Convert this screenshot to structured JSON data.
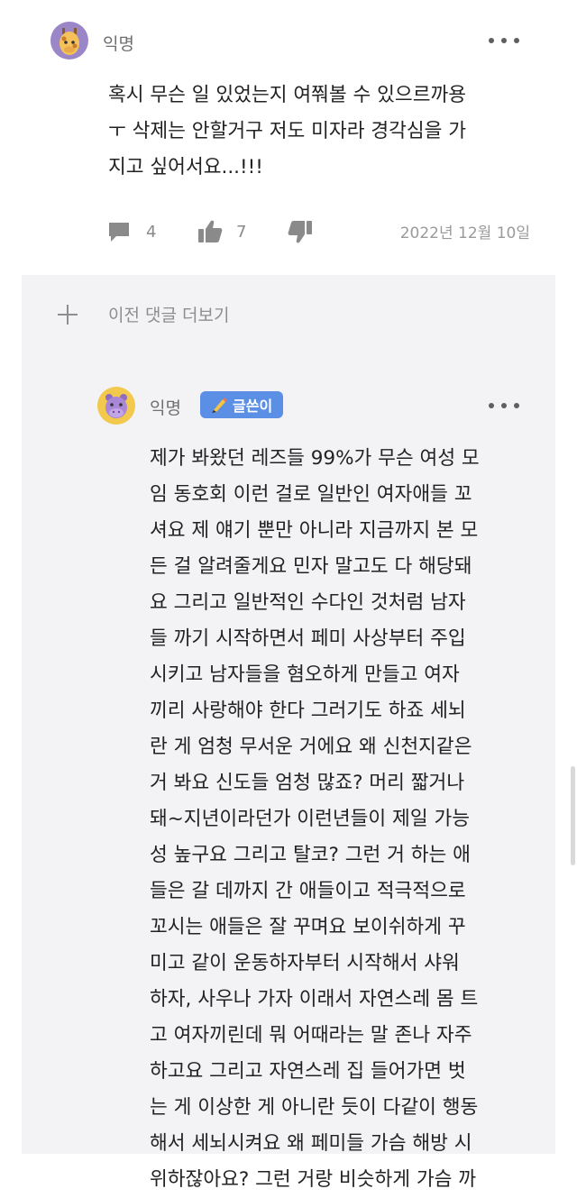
{
  "comment": {
    "author": "익명",
    "text": "혹시 무슨 일 있었는지 여쭤볼 수 있으르까용\nㅜ 삭제는 안할거구 저도 미자라 경각심을 가\n지고 싶어서요...!!!",
    "reply_count": "4",
    "like_count": "7",
    "date": "2022년 12월 10일",
    "avatar_icon": "giraffe-icon"
  },
  "reply_section": {
    "load_more_label": "이전 댓글 더보기",
    "reply": {
      "author": "익명",
      "badge_label": "글쓴이",
      "avatar_icon": "hippo-icon",
      "text": "제가 봐왔던 레즈들 99%가 무슨 여성 모\n임 동호회 이런 걸로 일반인 여자애들 꼬\n셔요 제 얘기 뿐만 아니라 지금까지 본 모\n든 걸 알려줄게요 민자 말고도 다 해당돼\n요 그리고 일반적인 수다인 것처럼 남자\n들 까기 시작하면서 페미 사상부터 주입\n시키고 남자들을 혐오하게 만들고 여자\n끼리 사랑해야 한다 그러기도 하죠 세뇌\n란 게 엄청 무서운 거에요 왜 신천지같은\n거 봐요 신도들 엄청 많죠? 머리 짧거나\n돼~지년이라던가 이런년들이 제일 가능\n성 높구요 그리고 탈코? 그런 거 하는 애\n들은 갈 데까지 간 애들이고 적극적으로\n꼬시는 애들은 잘 꾸며요 보이쉬하게 꾸\n미고 같이 운동하자부터 시작해서 샤워\n하자, 사우나 가자 이래서 자연스레 몸 트\n고 여자끼린데 뭐 어때라는 말 존나 자주\n하고요 그리고 자연스레 집 들어가면 벗\n는 게 이상한 게 아니란 듯이 다같이 행동\n해서 세뇌시켜요 왜 페미들 가슴 해방 시\n위하잖아요? 그런 거랑 비슷하게 가슴 까"
    }
  },
  "colors": {
    "background": "#ffffff",
    "reply_background": "#f3f3f5",
    "badge": "#5b8fe6",
    "giraffe_avatar_bg": "#9b86c7",
    "hippo_avatar_bg": "#f2c94c"
  }
}
